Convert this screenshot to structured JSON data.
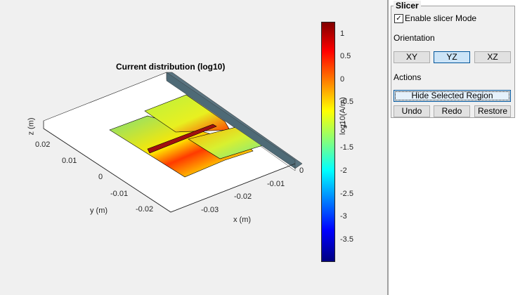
{
  "plot": {
    "title": "Current distribution (log10)",
    "xlabel": "x (m)",
    "ylabel": "y (m)",
    "zlabel": "z (m)",
    "x_ticks": [
      "0",
      "-0.01",
      "-0.02",
      "-0.03"
    ],
    "y_ticks": [
      "0.02",
      "0.01",
      "0",
      "-0.01",
      "-0.02"
    ],
    "colorbar": {
      "label": "log10(A/m)",
      "ticks": [
        "1",
        "0.5",
        "0",
        "-0.5",
        "-1",
        "-1.5",
        "-2",
        "-2.5",
        "-3",
        "-3.5"
      ],
      "range": [
        -3.98,
        1.27
      ]
    }
  },
  "slicer": {
    "title": "Slicer",
    "enable_label": "Enable slicer Mode",
    "enable_checked": true,
    "orientation_label": "Orientation",
    "orientations": [
      "XY",
      "YZ",
      "XZ"
    ],
    "selected_orientation": "YZ",
    "actions_label": "Actions",
    "hide_label": "Hide Selected Region",
    "undo_label": "Undo",
    "redo_label": "Redo",
    "restore_label": "Restore"
  }
}
